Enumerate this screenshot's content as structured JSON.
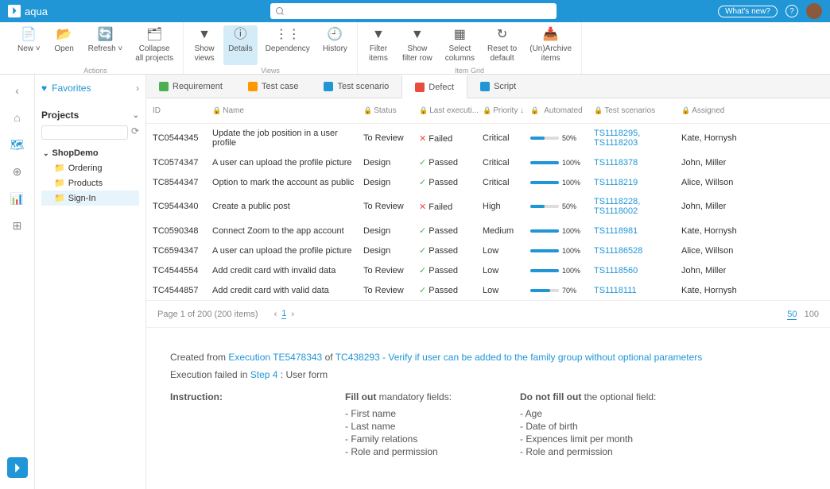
{
  "topbar": {
    "brand": "aqua",
    "whats_new": "What's new?",
    "search_placeholder": ""
  },
  "ribbon": {
    "groups": [
      {
        "caption": "Actions",
        "items": [
          {
            "icon": "📄",
            "label": "New ˅"
          },
          {
            "icon": "📂",
            "label": "Open"
          },
          {
            "icon": "🔄",
            "label": "Refresh ˅"
          },
          {
            "icon": "🗂",
            "label": "Collapse\nall projects"
          }
        ]
      },
      {
        "caption": "Views",
        "items": [
          {
            "icon": "▼",
            "label": "Show\nviews"
          },
          {
            "icon": "ⓘ",
            "label": "Details",
            "active": true
          },
          {
            "icon": "⋮⋮",
            "label": "Dependency"
          },
          {
            "icon": "🕘",
            "label": "History"
          }
        ]
      },
      {
        "caption": "Item Grid",
        "items": [
          {
            "icon": "▼",
            "label": "Filter\nitems"
          },
          {
            "icon": "▼",
            "label": "Show\nfilter row"
          },
          {
            "icon": "▦",
            "label": "Select\ncolumns"
          },
          {
            "icon": "↻",
            "label": "Reset to\ndefault"
          },
          {
            "icon": "📥",
            "label": "(Un)Archive\nitems"
          }
        ]
      }
    ]
  },
  "sidebar": {
    "favorites": "Favorites",
    "projects": "Projects",
    "tree": {
      "root": "ShopDemo",
      "children": [
        "Ordering",
        "Products",
        "Sign-In"
      ],
      "selected": "Sign-In"
    }
  },
  "tabs": [
    {
      "label": "Requirement",
      "color": "#4caf50"
    },
    {
      "label": "Test case",
      "color": "#ff9800"
    },
    {
      "label": "Test scenario",
      "color": "#2196d6"
    },
    {
      "label": "Defect",
      "color": "#e74c3c",
      "active": true
    },
    {
      "label": "Script",
      "color": "#2196d6"
    }
  ],
  "columns": [
    "ID",
    "Name",
    "Status",
    "Last executi...",
    "Priority ↓",
    "Automated",
    "Test scenarios",
    "Assigned"
  ],
  "rows": [
    {
      "id": "TC0544345",
      "name": "Update the job position in a user profile",
      "status": "To Review",
      "exec": "Failed",
      "prio": "Critical",
      "auto": 50,
      "scen": "TS1118295, TS1118203",
      "assign": "Kate, Hornysh"
    },
    {
      "id": "TC0574347",
      "name": "A user can upload the profile picture",
      "status": "Design",
      "exec": "Passed",
      "prio": "Critical",
      "auto": 100,
      "scen": "TS1118378",
      "assign": "John, Miller"
    },
    {
      "id": "TC8544347",
      "name": "Option to mark the account as public",
      "status": "Design",
      "exec": "Passed",
      "prio": "Critical",
      "auto": 100,
      "scen": "TS1118219",
      "assign": "Alice, Willson"
    },
    {
      "id": "TC9544340",
      "name": "Create a public post",
      "status": "To Review",
      "exec": "Failed",
      "prio": "High",
      "auto": 50,
      "scen": "TS1118228, TS1118002",
      "assign": "John, Miller"
    },
    {
      "id": "TC0590348",
      "name": "Connect Zoom to the app account",
      "status": "Design",
      "exec": "Passed",
      "prio": "Medium",
      "auto": 100,
      "scen": "TS1118981",
      "assign": "Kate, Hornysh"
    },
    {
      "id": "TC6594347",
      "name": "A user can upload the profile picture",
      "status": "Design",
      "exec": "Passed",
      "prio": "Low",
      "auto": 100,
      "scen": "TS11186528",
      "assign": "Alice, Willson"
    },
    {
      "id": "TC4544554",
      "name": "Add credit card with invalid data",
      "status": "To Review",
      "exec": "Passed",
      "prio": "Low",
      "auto": 100,
      "scen": "TS1118560",
      "assign": "John, Miller"
    },
    {
      "id": "TC4544857",
      "name": "Add credit card with valid data",
      "status": "To Review",
      "exec": "Passed",
      "prio": "Low",
      "auto": 70,
      "scen": "TS1118111",
      "assign": "Kate, Hornysh"
    }
  ],
  "pager": {
    "text": "Page 1 of 200 (200 items)",
    "page": "1",
    "sizes": [
      "50",
      "100"
    ],
    "selected": "50"
  },
  "detail": {
    "created_prefix": "Created from ",
    "execution": "Execution TE5478343",
    "of": " of ",
    "tc": "TC438293 - Verify if user can be added to the family group without optional parameters",
    "exec_failed_prefix": "Execution failed in ",
    "step": "Step 4",
    "step_suffix": ": User form",
    "instruction_label": "Instruction:",
    "fillout_label": "Fill out ",
    "fillout_suffix": "mandatory fields:",
    "fillout_items": [
      "- First name",
      "- Last name",
      "- Family relations",
      "- Role and permission"
    ],
    "donot_label": "Do not fill out ",
    "donot_suffix": "the optional field:",
    "donot_items": [
      "- Age",
      "- Date of birth",
      "- Expences limit per month",
      "- Role and permission"
    ]
  }
}
